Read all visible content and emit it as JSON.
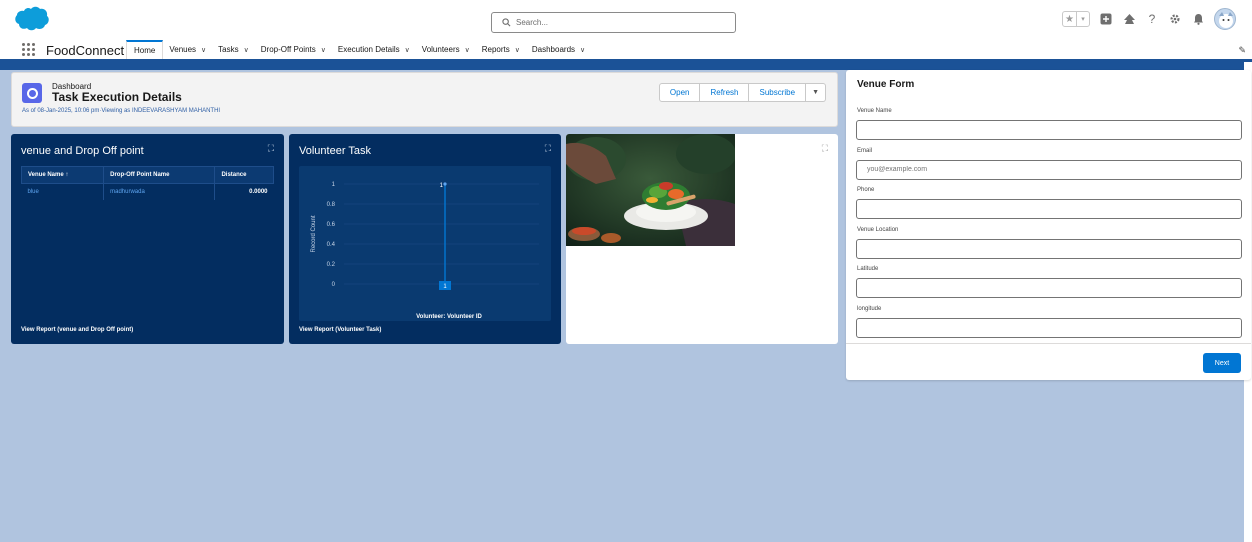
{
  "header": {
    "search_placeholder": "Search...",
    "icons": [
      "favorites-star-icon",
      "favorites-list-icon",
      "global-actions-icon",
      "trailhead-icon",
      "help-icon",
      "setup-gear-icon",
      "notifications-bell-icon",
      "user-avatar"
    ]
  },
  "nav": {
    "app_name": "FoodConnect",
    "items": [
      {
        "label": "Home",
        "active": true,
        "has_menu": false
      },
      {
        "label": "Venues",
        "active": false,
        "has_menu": true
      },
      {
        "label": "Tasks",
        "active": false,
        "has_menu": true
      },
      {
        "label": "Drop-Off Points",
        "active": false,
        "has_menu": true
      },
      {
        "label": "Execution Details",
        "active": false,
        "has_menu": true
      },
      {
        "label": "Volunteers",
        "active": false,
        "has_menu": true
      },
      {
        "label": "Reports",
        "active": false,
        "has_menu": true
      },
      {
        "label": "Dashboards",
        "active": false,
        "has_menu": true
      }
    ]
  },
  "dashboard": {
    "eyebrow": "Dashboard",
    "title": "Task Execution Details",
    "meta": "As of 08-Jan-2025, 10:06 pm·Viewing as INDEEVARASHYAM MAHANTHI",
    "buttons": {
      "open": "Open",
      "refresh": "Refresh",
      "subscribe": "Subscribe"
    }
  },
  "widget_venue": {
    "title": "venue and Drop Off point",
    "columns": [
      "Venue Name ↑",
      "Drop-Off Point Name",
      "Distance"
    ],
    "rows": [
      {
        "venue": "blue",
        "dropoff": "madhurwada",
        "distance": "0.0000"
      }
    ],
    "footer": "View Report (venue and Drop Off point)"
  },
  "widget_volunteer": {
    "title": "Volunteer Task",
    "footer": "View Report (Volunteer Task)"
  },
  "chart_data": {
    "type": "bar",
    "title": "Volunteer Task",
    "xlabel": "Volunteer: Volunteer ID",
    "ylabel": "Record Count",
    "y_ticks": [
      "0",
      "0.2",
      "0.4",
      "0.6",
      "0.8",
      "1"
    ],
    "ylim": [
      0,
      1
    ],
    "categories": [
      ""
    ],
    "values": [
      1
    ],
    "data_labels": [
      "1",
      "1"
    ],
    "colors": {
      "bar": "#0176d3",
      "highlight": "#5ea4ef"
    }
  },
  "form": {
    "title": "Venue Form",
    "fields": [
      {
        "label": "Venue Name",
        "placeholder": "",
        "value": ""
      },
      {
        "label": "Email",
        "placeholder": "you@example.com",
        "value": ""
      },
      {
        "label": "Phone",
        "placeholder": "",
        "value": ""
      },
      {
        "label": "Venue Location",
        "placeholder": "",
        "value": ""
      },
      {
        "label": "Latitude",
        "placeholder": "",
        "value": ""
      },
      {
        "label": "longitude",
        "placeholder": "",
        "value": ""
      }
    ],
    "submit_label": "Next"
  },
  "colors": {
    "brand": "#0176d3",
    "nav_band": "#1b5297",
    "widget_bg": "#032d60",
    "page_bg": "#b0c4df",
    "link": "#5ea4ef"
  }
}
